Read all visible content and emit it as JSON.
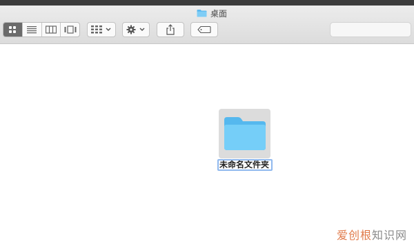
{
  "window": {
    "title": "桌面"
  },
  "toolbar": {
    "view_modes": [
      {
        "name": "icon-view",
        "active": true
      },
      {
        "name": "list-view",
        "active": false
      },
      {
        "name": "column-view",
        "active": false
      },
      {
        "name": "gallery-view",
        "active": false
      }
    ],
    "search_placeholder": ""
  },
  "folder": {
    "name": "未命名文件夹"
  },
  "watermark": {
    "brand": "爱创根",
    "suffix": "知识网"
  },
  "colors": {
    "folder_blue": "#6ccbf7",
    "toolbar_bg": "#e6e6e6",
    "selection_border": "#8fb8ee"
  }
}
